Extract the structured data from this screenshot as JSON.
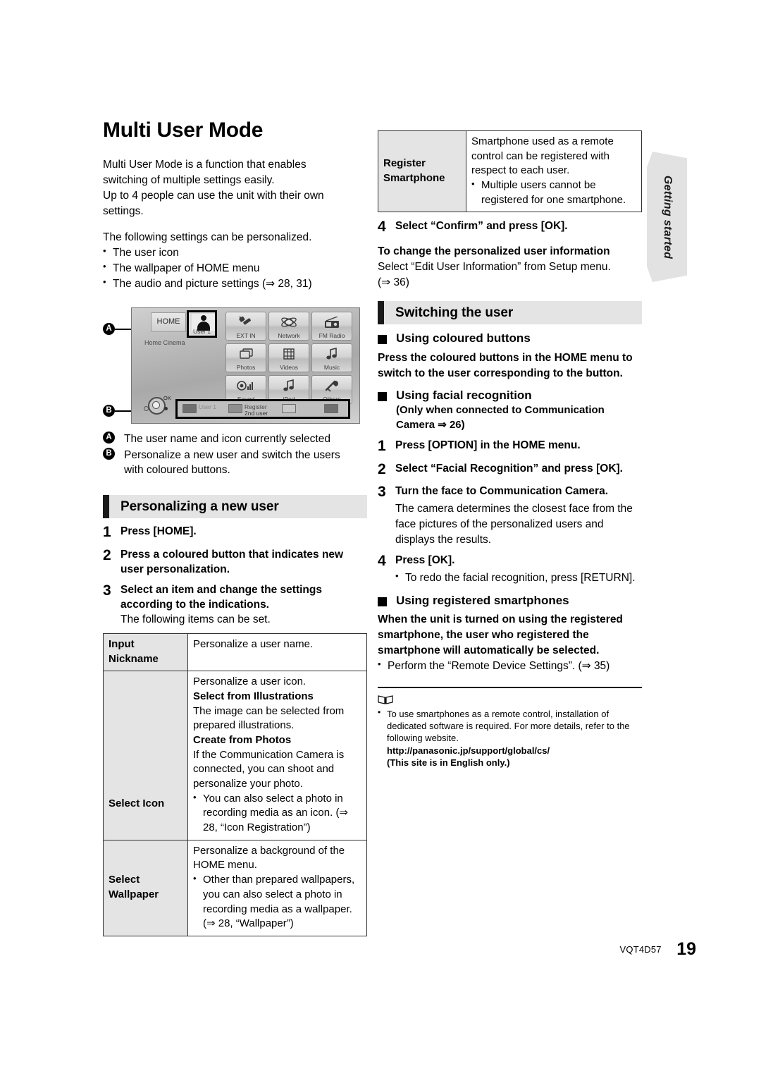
{
  "page": {
    "title": "Multi User Mode",
    "footer_code": "VQT4D57",
    "page_number": "19",
    "side_tab": "Getting started"
  },
  "intro": {
    "para1_line1": "Multi User Mode is a function that enables",
    "para1_line2": "switching of multiple settings easily.",
    "para1_line3": "Up to 4 people can use the unit with their own",
    "para1_line4": "settings.",
    "para2": "The following settings can be personalized.",
    "bullets": [
      "The user icon",
      "The wallpaper of HOME menu",
      "The audio and picture settings (⇒ 28, 31)"
    ]
  },
  "home_menu": {
    "home_button": "HOME",
    "user_tile_label": "User 1",
    "home_cinema_label": "Home Cinema",
    "ok_label": "OK",
    "tiles": [
      {
        "label": "EXT IN",
        "icon": "plug-icon"
      },
      {
        "label": "Network",
        "icon": "globe-icon"
      },
      {
        "label": "FM Radio",
        "icon": "radio-icon"
      },
      {
        "label": "Photos",
        "icon": "photos-icon"
      },
      {
        "label": "Videos",
        "icon": "film-icon"
      },
      {
        "label": "Music",
        "icon": "music-note-icon"
      },
      {
        "label": "Sound",
        "icon": "speaker-icon"
      },
      {
        "label": "iPod",
        "icon": "ipod-note-icon"
      },
      {
        "label": "Others",
        "icon": "wrench-icon"
      }
    ],
    "colour_buttons": [
      {
        "label": "User 1",
        "sub": "",
        "colour": "#6f6f6f"
      },
      {
        "label": "Register",
        "sub": "2nd user",
        "colour": "#8f8f8f"
      },
      {
        "label": "",
        "sub": "",
        "colour": "#c9c9c9"
      },
      {
        "label": "",
        "sub": "",
        "colour": "#6f6f6f"
      }
    ],
    "callouts": {
      "a": "A",
      "b": "B"
    }
  },
  "legend": {
    "a_label": "A",
    "a_text": "The user name and icon currently selected",
    "b_label": "B",
    "b_text_line1": "Personalize a new user and switch the users",
    "b_text_line2": "with coloured buttons."
  },
  "personalizing": {
    "heading": "Personalizing a new user",
    "steps": [
      {
        "num": "1",
        "text": "Press [HOME]."
      },
      {
        "num": "2",
        "text": "Press a coloured button that indicates new user personalization."
      },
      {
        "num": "3",
        "text": "Select an item and change the settings according to the indications.",
        "note": "The following items can be set."
      }
    ]
  },
  "settings_table": {
    "rows": [
      {
        "header": "Input Nickname",
        "blocks": [
          {
            "type": "text",
            "text": "Personalize a user name."
          }
        ]
      },
      {
        "header": "Select Icon",
        "blocks": [
          {
            "type": "text",
            "text": "Personalize a user icon."
          },
          {
            "type": "bold",
            "text": "Select from Illustrations"
          },
          {
            "type": "text",
            "text": "The image can be selected from prepared illustrations."
          },
          {
            "type": "bold",
            "text": "Create from Photos"
          },
          {
            "type": "text",
            "text": "If the Communication Camera is connected, you can shoot and personalize your photo."
          },
          {
            "type": "bullet",
            "text": "You can also select a photo in recording media as an icon. (⇒ 28, “Icon Registration”)"
          }
        ]
      },
      {
        "header": "Select Wallpaper",
        "blocks": [
          {
            "type": "text",
            "text": "Personalize a background of the HOME menu."
          },
          {
            "type": "bullet",
            "text": "Other than prepared wallpapers, you can also select a photo in recording media as a wallpaper. (⇒ 28, “Wallpaper”)"
          }
        ]
      }
    ]
  },
  "register_table": {
    "header": "Register Smartphone",
    "blocks": [
      {
        "type": "text",
        "text": "Smartphone used as a remote control can be registered with respect to each user."
      },
      {
        "type": "bullet",
        "text": "Multiple users cannot be registered for one smartphone."
      }
    ]
  },
  "confirm_step": {
    "num": "4",
    "text": "Select “Confirm” and press [OK]."
  },
  "change_info": {
    "heading": "To change the personalized user information",
    "line1": "Select “Edit User Information” from Setup menu.",
    "line2": "(⇒ 36)"
  },
  "switching": {
    "heading": "Switching the user",
    "coloured": {
      "heading": "Using coloured buttons",
      "body": "Press the coloured buttons in the HOME menu to switch to the user corresponding to the button."
    },
    "facial": {
      "heading": "Using facial recognition",
      "sub_line1": "(Only when connected to Communication",
      "sub_line2": "Camera ⇒ 26)",
      "steps": [
        {
          "num": "1",
          "text": "Press [OPTION] in the HOME menu."
        },
        {
          "num": "2",
          "text": "Select “Facial Recognition” and press [OK]."
        },
        {
          "num": "3",
          "text": "Turn the face to Communication Camera.",
          "note": "The camera determines the closest face from the face pictures of the personalized users and displays the results."
        },
        {
          "num": "4",
          "text": "Press [OK].",
          "sub": "To redo the facial recognition, press [RETURN]."
        }
      ]
    },
    "smartphones": {
      "heading": "Using registered smartphones",
      "body": "When the unit is turned on using the registered smartphone, the user who registered the smartphone will automatically be selected.",
      "bullet": "Perform the “Remote Device Settings”. (⇒ 35)"
    }
  },
  "note_block": {
    "line1": "To use smartphones as a remote control, installation of dedicated software is required. For more details, refer to the following website.",
    "url": "http://panasonic.jp/support/global/cs/",
    "line2": "(This site is in English only.)"
  }
}
